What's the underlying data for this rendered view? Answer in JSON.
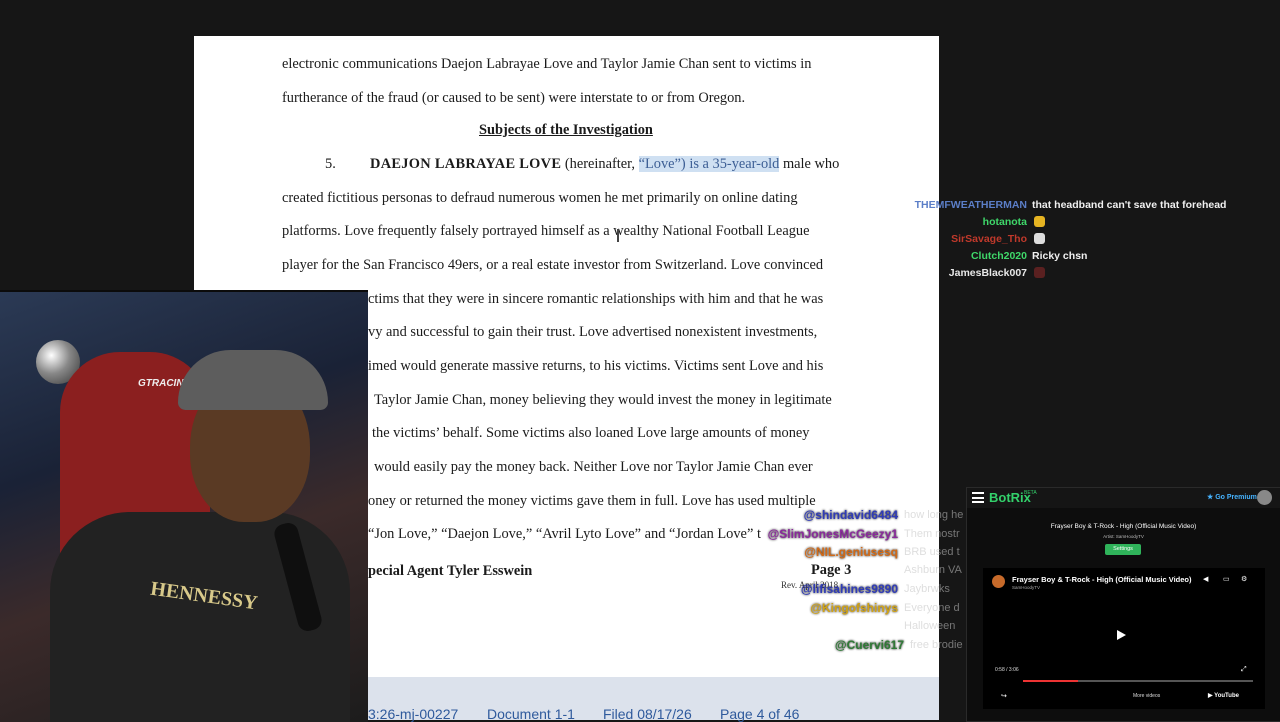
{
  "document": {
    "line1": "electronic communications Daejon Labrayae Love and Taylor Jamie Chan sent to victims in",
    "line2": "furtherance of the fraud (or caused to be sent) were interstate to or from Oregon.",
    "heading": "Subjects of the Investigation",
    "para_number": "5.",
    "para_name": "DAEJON LABRAYAE LOVE",
    "para_intro": " (hereinafter, ",
    "para_highlight": "“Love”) is a 35-year-old",
    "para_intro_end": " male who",
    "line4": "created fictitious personas to defraud numerous women he met primarily on online dating",
    "line5": "platforms. Love frequently falsely portrayed himself as a wealthy National Football League",
    "line6": "player for the San Francisco 49ers, or a real estate investor from Switzerland. Love convinced",
    "line7": "ctims that they were in sincere romantic relationships with him and that he was",
    "line8": "vy and successful to gain their trust. Love advertised nonexistent investments,",
    "line9": "imed would generate massive returns, to his victims. Victims sent Love and his",
    "line10": "Taylor Jamie Chan, money believing they would invest the money in legitimate",
    "line11": "the victims’ behalf. Some victims also loaned Love large amounts of money",
    "line12": "would easily pay the money back. Neither Love nor Taylor Jamie Chan ever",
    "line13": "oney or returned the money victims gave them in full. Love has used multiple",
    "line14": "“Jon Love,” “Daejon Love,” “Avril Lyto Love” and “Jordan Love”",
    "line14_tail": "t",
    "signature": "pecial Agent Tyler Esswein",
    "page_label": "Page 3",
    "rev": "Rev. April 2018"
  },
  "footer": {
    "case": "3:26-mj-00227",
    "document": "Document 1-1",
    "filed": "Filed 08/17/26",
    "page": "Page 4 of 46"
  },
  "chat_top": [
    {
      "name": "THEMFWEATHERMAN",
      "color": "#5b7ec7",
      "msg": "that headband can't save that forehead"
    },
    {
      "name": "hotanota",
      "color": "#3fd86a",
      "msg": ""
    },
    {
      "name": "SirSavage_Tho",
      "color": "#c0392b",
      "msg": ""
    },
    {
      "name": "Clutch2020",
      "color": "#3fd86a",
      "msg": "Ricky chsn"
    },
    {
      "name": "JamesBlack007",
      "color": "#e8e8e8",
      "msg": ""
    }
  ],
  "chat_bottom": [
    {
      "name": "@shindavid6484",
      "color": "#2f3bb8",
      "msg": "how long he"
    },
    {
      "name": "@SlimJonesMcGeezy1",
      "color": "#8a2a9c",
      "msg": "Them nostr"
    },
    {
      "name": "@NIL.geniusesq",
      "color": "#d26a17",
      "msg": "BRB used t"
    },
    {
      "name": "",
      "color": "#ffffff",
      "msg": "Ashburn VA"
    },
    {
      "name": "@lifisahines9890",
      "color": "#2f3bb8",
      "msg": "Jaybrwks"
    },
    {
      "name": "@Kingofshinys",
      "color": "#d2a417",
      "msg": "Everyone d"
    },
    {
      "name": "",
      "color": "#ffffff",
      "msg": "Halloween"
    },
    {
      "name": "@Cuervi617",
      "color": "#2f7a36",
      "msg": "free brodie"
    }
  ],
  "botrix": {
    "logo": "BotRix",
    "beta": "BETA",
    "premium": "★ Go Premium",
    "now_playing": "Frayser Boy & T-Rock - High (Official Music Video)",
    "artist": "Artist: SamHoodyTV",
    "settings": "Settings",
    "video_title": "Frayser Boy & T-Rock - High (Official Music Video)",
    "video_channel": "SamHoodyTV",
    "time": "0:58 / 3:06",
    "progress": 0.24,
    "more_videos": "More videos",
    "youtube": "▶ YouTube"
  },
  "webcam": {
    "chair_logo": "GTRACING",
    "shirt": "HENNESSY"
  }
}
